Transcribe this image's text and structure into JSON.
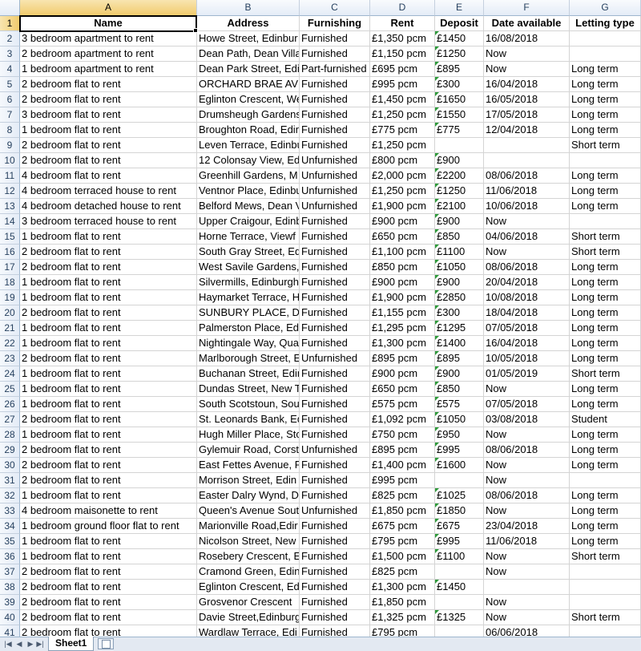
{
  "columns": [
    "A",
    "B",
    "C",
    "D",
    "E",
    "F",
    "G"
  ],
  "selected_column": "A",
  "selected_row": "1",
  "headers": [
    "Name",
    "Address",
    "Furnishing",
    "Rent",
    "Deposit",
    "Date available",
    "Letting type"
  ],
  "rows": [
    {
      "n": "2",
      "a": "3 bedroom apartment to rent",
      "b": "Howe Street, Edinbur",
      "c": "Furnished",
      "d": "£1,350 pcm",
      "e": "£1450",
      "f": "16/08/2018",
      "g": ""
    },
    {
      "n": "3",
      "a": "2 bedroom apartment to rent",
      "b": "Dean Path, Dean Villa",
      "c": "Furnished",
      "d": "£1,150 pcm",
      "e": "£1250",
      "f": "Now",
      "g": ""
    },
    {
      "n": "4",
      "a": "1 bedroom apartment to rent",
      "b": "Dean Park Street, Edi",
      "c": "Part-furnished",
      "d": "£695 pcm",
      "e": "£895",
      "f": "Now",
      "g": "Long term"
    },
    {
      "n": "5",
      "a": "2 bedroom flat to rent",
      "b": "ORCHARD BRAE AVEN",
      "c": "Furnished",
      "d": "£995 pcm",
      "e": "£300",
      "f": "16/04/2018",
      "g": "Long term"
    },
    {
      "n": "6",
      "a": "2 bedroom flat to rent",
      "b": "Eglinton Crescent, We",
      "c": "Furnished",
      "d": "£1,450 pcm",
      "e": "£1650",
      "f": "16/05/2018",
      "g": "Long term"
    },
    {
      "n": "7",
      "a": "3 bedroom flat to rent",
      "b": "Drumsheugh Gardens",
      "c": "Furnished",
      "d": "£1,250 pcm",
      "e": "£1550",
      "f": "17/05/2018",
      "g": "Long term"
    },
    {
      "n": "8",
      "a": "1 bedroom flat to rent",
      "b": "Broughton Road, Edin",
      "c": "Furnished",
      "d": "£775 pcm",
      "e": "£775",
      "f": "12/04/2018",
      "g": "Long term"
    },
    {
      "n": "9",
      "a": "2 bedroom flat to rent",
      "b": "Leven Terrace, Edinbu",
      "c": "Furnished",
      "d": "£1,250 pcm",
      "e": "",
      "f": "",
      "g": "Short term"
    },
    {
      "n": "10",
      "a": "2 bedroom flat to rent",
      "b": "12 Colonsay View, Edi",
      "c": "Unfurnished",
      "d": "£800 pcm",
      "e": "£900",
      "f": "",
      "g": ""
    },
    {
      "n": "11",
      "a": "4 bedroom flat to rent",
      "b": "Greenhill Gardens, M",
      "c": "Unfurnished",
      "d": "£2,000 pcm",
      "e": "£2200",
      "f": "08/06/2018",
      "g": "Long term"
    },
    {
      "n": "12",
      "a": "4 bedroom terraced house to rent",
      "b": "Ventnor Place, Edinbu",
      "c": "Unfurnished",
      "d": "£1,250 pcm",
      "e": "£1250",
      "f": "11/06/2018",
      "g": "Long term"
    },
    {
      "n": "13",
      "a": "4 bedroom detached house to rent",
      "b": "Belford Mews, Dean V",
      "c": "Unfurnished",
      "d": "£1,900 pcm",
      "e": "£2100",
      "f": "10/06/2018",
      "g": "Long term"
    },
    {
      "n": "14",
      "a": "3 bedroom terraced house to rent",
      "b": "Upper Craigour, Edinb",
      "c": "Furnished",
      "d": "£900 pcm",
      "e": "£900",
      "f": "Now",
      "g": ""
    },
    {
      "n": "15",
      "a": "1 bedroom flat to rent",
      "b": "Horne Terrace, Viewf",
      "c": "Furnished",
      "d": "£650 pcm",
      "e": "£850",
      "f": "04/06/2018",
      "g": "Short term"
    },
    {
      "n": "16",
      "a": "2 bedroom flat to rent",
      "b": "South Gray Street, Edi",
      "c": "Furnished",
      "d": "£1,100 pcm",
      "e": "£1100",
      "f": "Now",
      "g": "Short term"
    },
    {
      "n": "17",
      "a": "2 bedroom flat to rent",
      "b": "West Savile Gardens,",
      "c": "Furnished",
      "d": "£850 pcm",
      "e": "£1050",
      "f": "08/06/2018",
      "g": "Long term"
    },
    {
      "n": "18",
      "a": "1 bedroom flat to rent",
      "b": "Silvermills, Edinburgh",
      "c": "Furnished",
      "d": "£900 pcm",
      "e": "£900",
      "f": "20/04/2018",
      "g": "Long term"
    },
    {
      "n": "19",
      "a": "1 bedroom flat to rent",
      "b": "Haymarket Terrace, H",
      "c": "Furnished",
      "d": "£1,900 pcm",
      "e": "£2850",
      "f": "10/08/2018",
      "g": "Long term"
    },
    {
      "n": "20",
      "a": "2 bedroom flat to rent",
      "b": "SUNBURY PLACE, DEA",
      "c": "Furnished",
      "d": "£1,155 pcm",
      "e": "£300",
      "f": "18/04/2018",
      "g": "Long term"
    },
    {
      "n": "21",
      "a": "1 bedroom flat to rent",
      "b": "Palmerston Place, Edi",
      "c": "Furnished",
      "d": "£1,295 pcm",
      "e": "£1295",
      "f": "07/05/2018",
      "g": "Long term"
    },
    {
      "n": "22",
      "a": "1 bedroom flat to rent",
      "b": "Nightingale Way, Qua",
      "c": "Furnished",
      "d": "£1,300 pcm",
      "e": "£1400",
      "f": "16/04/2018",
      "g": "Long term"
    },
    {
      "n": "23",
      "a": "2 bedroom flat to rent",
      "b": "Marlborough Street, E",
      "c": "Unfurnished",
      "d": "£895 pcm",
      "e": "£895",
      "f": "10/05/2018",
      "g": "Long term"
    },
    {
      "n": "24",
      "a": "1 bedroom flat to rent",
      "b": "Buchanan Street, Edin",
      "c": "Furnished",
      "d": "£900 pcm",
      "e": "£900",
      "f": "01/05/2019",
      "g": "Short term"
    },
    {
      "n": "25",
      "a": "1 bedroom flat to rent",
      "b": "Dundas Street, New T",
      "c": "Furnished",
      "d": "£650 pcm",
      "e": "£850",
      "f": "Now",
      "g": "Long term"
    },
    {
      "n": "26",
      "a": "1 bedroom flat to rent",
      "b": "South Scotstoun, Sout",
      "c": "Furnished",
      "d": "£575 pcm",
      "e": "£575",
      "f": "07/05/2018",
      "g": "Long term"
    },
    {
      "n": "27",
      "a": "2 bedroom flat to rent",
      "b": "St. Leonards Bank, Edi",
      "c": "Furnished",
      "d": "£1,092 pcm",
      "e": "£1050",
      "f": "03/08/2018",
      "g": "Student"
    },
    {
      "n": "28",
      "a": "1 bedroom flat to rent",
      "b": "Hugh Miller Place, Sto",
      "c": "Furnished",
      "d": "£750 pcm",
      "e": "£950",
      "f": "Now",
      "g": "Long term"
    },
    {
      "n": "29",
      "a": "2 bedroom flat to rent",
      "b": "Gylemuir Road, Corsto",
      "c": "Unfurnished",
      "d": "£895 pcm",
      "e": "£995",
      "f": "08/06/2018",
      "g": "Long term"
    },
    {
      "n": "30",
      "a": "2 bedroom flat to rent",
      "b": "East Fettes Avenue, F",
      "c": "Furnished",
      "d": "£1,400 pcm",
      "e": "£1600",
      "f": "Now",
      "g": "Long term"
    },
    {
      "n": "31",
      "a": "2 bedroom flat to rent",
      "b": "Morrison Street, Edin",
      "c": "Furnished",
      "d": "£995 pcm",
      "e": "",
      "f": "Now",
      "g": ""
    },
    {
      "n": "32",
      "a": "1 bedroom flat to rent",
      "b": "Easter Dalry Wynd, Da",
      "c": "Furnished",
      "d": "£825 pcm",
      "e": "£1025",
      "f": "08/06/2018",
      "g": "Long term"
    },
    {
      "n": "33",
      "a": "4 bedroom maisonette to rent",
      "b": "Queen's Avenue Sout",
      "c": "Unfurnished",
      "d": "£1,850 pcm",
      "e": "£1850",
      "f": "Now",
      "g": "Long term"
    },
    {
      "n": "34",
      "a": "1 bedroom ground floor flat to rent",
      "b": "Marionville Road,Edir",
      "c": "Furnished",
      "d": "£675 pcm",
      "e": "£675",
      "f": "23/04/2018",
      "g": "Long term"
    },
    {
      "n": "35",
      "a": "1 bedroom flat to rent",
      "b": "Nicolson Street, New",
      "c": "Furnished",
      "d": "£795 pcm",
      "e": "£995",
      "f": "11/06/2018",
      "g": "Long term"
    },
    {
      "n": "36",
      "a": "1 bedroom flat to rent",
      "b": "Rosebery Crescent, Ed",
      "c": "Furnished",
      "d": "£1,500 pcm",
      "e": "£1100",
      "f": "Now",
      "g": "Short term"
    },
    {
      "n": "37",
      "a": "2 bedroom flat to rent",
      "b": "Cramond Green, Edin",
      "c": "Furnished",
      "d": "£825 pcm",
      "e": "",
      "f": "Now",
      "g": ""
    },
    {
      "n": "38",
      "a": "2 bedroom flat to rent",
      "b": "Eglinton Crescent, Edi",
      "c": "Furnished",
      "d": "£1,300 pcm",
      "e": "£1450",
      "f": "",
      "g": ""
    },
    {
      "n": "39",
      "a": "2 bedroom flat to rent",
      "b": "Grosvenor Crescent",
      "c": "Furnished",
      "d": "£1,850 pcm",
      "e": "",
      "f": "Now",
      "g": ""
    },
    {
      "n": "40",
      "a": "2 bedroom flat to rent",
      "b": "Davie Street,Edinburg",
      "c": "Furnished",
      "d": "£1,325 pcm",
      "e": "£1325",
      "f": "Now",
      "g": "Short term"
    },
    {
      "n": "41",
      "a": "2 bedroom flat to rent",
      "b": "Wardlaw Terrace, Edi",
      "c": "Furnished",
      "d": "£795 pcm",
      "e": "",
      "f": "06/06/2018",
      "g": ""
    }
  ],
  "sheet_tab": "Sheet1",
  "colors": {
    "header_bg": "#e4ecf7",
    "selected_header": "#f1cb6d",
    "gridline": "#d4d4d4",
    "indicator": "#2e9a3a"
  }
}
